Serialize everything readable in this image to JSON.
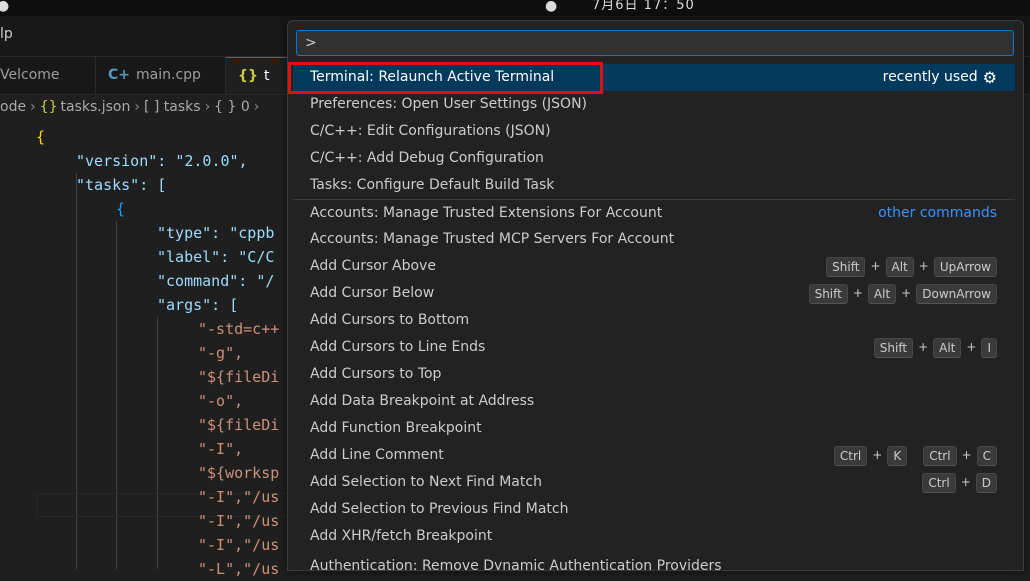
{
  "system": {
    "clock": "7月6日 17：50"
  },
  "menubar": {
    "partial_menu": "lp"
  },
  "tabs": [
    {
      "label": "Velcome",
      "icon": ""
    },
    {
      "label": "main.cpp",
      "icon": "C+"
    },
    {
      "label": "t",
      "icon": "{}"
    }
  ],
  "breadcrumbs": {
    "segments": [
      "ode",
      "tasks.json",
      "[ ] tasks",
      "{ } 0"
    ]
  },
  "editor": {
    "lines": [
      "{",
      "\"version\": \"2.0.0\",",
      "\"tasks\": [",
      "{",
      "\"type\": \"cppb",
      "\"label\": \"C/C",
      "\"command\": \"/",
      "\"args\": [",
      "\"-std=c++",
      "\"-g\",",
      "\"${fileDi",
      "\"-o\",",
      "\"${fileDi",
      "\"-I\",",
      "\"${worksp",
      "\"-I\",\"/us",
      "\"-I\",\"/us",
      "\"-I\",\"/us",
      "\"-L\",\"/us"
    ]
  },
  "palette": {
    "input_value": ">",
    "recently_used_label": "recently used",
    "other_commands_label": "other commands",
    "items": [
      {
        "label": "Terminal: Relaunch Active Terminal",
        "keys": []
      },
      {
        "label": "Preferences: Open User Settings (JSON)",
        "keys": []
      },
      {
        "label": "C/C++: Edit Configurations (JSON)",
        "keys": []
      },
      {
        "label": "C/C++: Add Debug Configuration",
        "keys": []
      },
      {
        "label": "Tasks: Configure Default Build Task",
        "keys": []
      },
      {
        "label": "Accounts: Manage Trusted Extensions For Account",
        "keys": []
      },
      {
        "label": "Accounts: Manage Trusted MCP Servers For Account",
        "keys": []
      },
      {
        "label": "Add Cursor Above",
        "keys": [
          [
            "Shift",
            "Alt",
            "UpArrow"
          ]
        ]
      },
      {
        "label": "Add Cursor Below",
        "keys": [
          [
            "Shift",
            "Alt",
            "DownArrow"
          ]
        ]
      },
      {
        "label": "Add Cursors to Bottom",
        "keys": []
      },
      {
        "label": "Add Cursors to Line Ends",
        "keys": [
          [
            "Shift",
            "Alt",
            "I"
          ]
        ]
      },
      {
        "label": "Add Cursors to Top",
        "keys": []
      },
      {
        "label": "Add Data Breakpoint at Address",
        "keys": []
      },
      {
        "label": "Add Function Breakpoint",
        "keys": []
      },
      {
        "label": "Add Line Comment",
        "keys": [
          [
            "Ctrl",
            "K"
          ],
          [
            "Ctrl",
            "C"
          ]
        ]
      },
      {
        "label": "Add Selection to Next Find Match",
        "keys": [
          [
            "Ctrl",
            "D"
          ]
        ]
      },
      {
        "label": "Add Selection to Previous Find Match",
        "keys": []
      },
      {
        "label": "Add XHR/fetch Breakpoint",
        "keys": []
      },
      {
        "label": "Authentication: Remove Dynamic Authentication Providers",
        "keys": []
      }
    ]
  }
}
